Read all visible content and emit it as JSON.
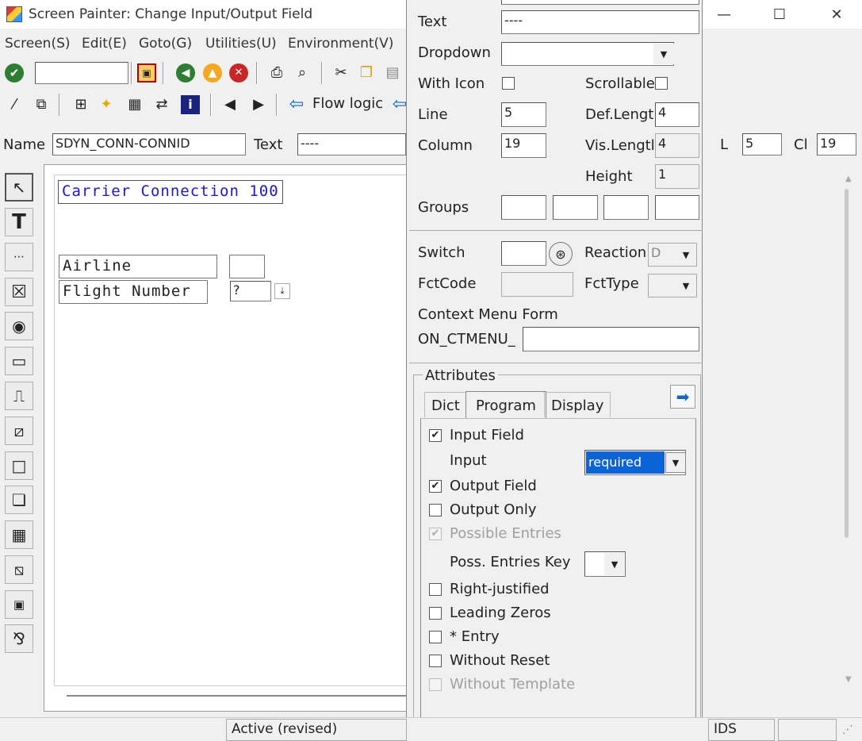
{
  "window": {
    "title": "Screen Painter:  Change Input/Output Field",
    "controls": {
      "minimize": "—",
      "maximize": "☐",
      "close": "✕"
    }
  },
  "menu": [
    "Screen(S)",
    "Edit(E)",
    "Goto(G)",
    "Utilities(U)",
    "Environment(V)"
  ],
  "toolbar2": {
    "flow_logic_label": "Flow logic"
  },
  "namebar": {
    "name_label": "Name",
    "name_value": "SDYN_CONN-CONNID",
    "text_label": "Text",
    "text_value": "----",
    "l_label": "L",
    "l_value": "5",
    "cl_label": "Cl",
    "cl_value": "19"
  },
  "canvas": {
    "title_box": "Carrier Connection 100",
    "airline_label": "Airline",
    "flight_label": "Flight Number",
    "flight_value": "?"
  },
  "dialog": {
    "text_label": "Text",
    "text_value": "----",
    "dropdown_label": "Dropdown",
    "with_icon_label": "With Icon",
    "scrollable_label": "Scrollable",
    "line_label": "Line",
    "line_value": "5",
    "def_length_label": "Def.Length",
    "def_length_value": "4",
    "column_label": "Column",
    "column_value": "19",
    "vis_length_label": "Vis.Length",
    "vis_length_value": "4",
    "height_label": "Height",
    "height_value": "1",
    "groups_label": "Groups",
    "switch_label": "Switch",
    "reaction_label": "Reaction",
    "reaction_value": "D",
    "fctcode_label": "FctCode",
    "fcttype_label": "FctType",
    "context_menu_label": "Context Menu Form",
    "on_ctmenu_label": "ON_CTMENU_",
    "attributes_label": "Attributes",
    "tabs": [
      "Dict",
      "Program",
      "Display"
    ],
    "input_field_label": "Input Field",
    "input_label": "Input",
    "input_value": "required",
    "output_field_label": "Output Field",
    "output_only_label": "Output Only",
    "possible_entries_label": "Possible Entries",
    "poss_entries_key_label": "Poss. Entries Key",
    "right_justified_label": "Right-justified",
    "leading_zeros_label": "Leading Zeros",
    "star_entry_label": "* Entry",
    "without_reset_label": "Without Reset",
    "without_template_label": "Without Template"
  },
  "status": {
    "state": "Active (revised)",
    "system": "IDS"
  },
  "colors": {
    "blue_text": "#1a1acc",
    "selection": "#0a64d8",
    "arrow_blue": "#1565c0"
  },
  "icons": [
    "check-icon",
    "save-icon",
    "back-icon",
    "exit-icon",
    "cancel-icon",
    "print-icon",
    "find-icon",
    "cut-icon",
    "copy-icon",
    "paste-icon"
  ]
}
